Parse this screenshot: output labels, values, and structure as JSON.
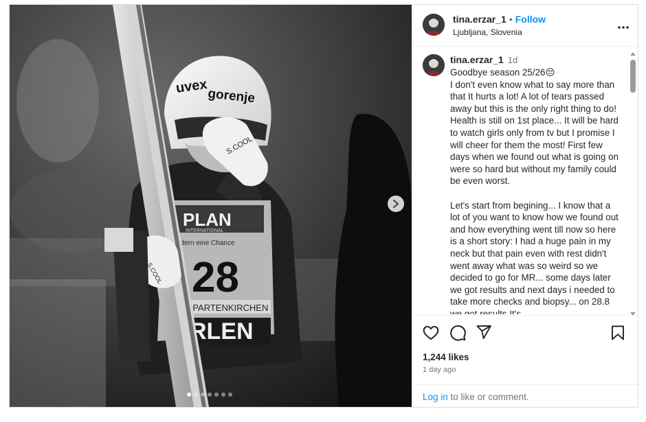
{
  "post": {
    "username": "tina.erzar_1",
    "separator": "•",
    "follow_label": "Follow",
    "location": "Ljubljana, Slovenia",
    "more_icon": "more-horizontal-icon",
    "media": {
      "bib_number": "28",
      "sponsor_text": "PLAN",
      "sponsor_sub": "INTERNATIONAL",
      "slogan": "ndern eine Chance",
      "venue": "-PARTENKIRCHEN",
      "brand_bottom": "RLEN",
      "helmet_brand_1": "uvex",
      "helmet_brand_2": "gorenje",
      "glove_brand": "S.COOL",
      "carousel_slides": 7,
      "carousel_active_index": 0
    },
    "caption": {
      "username": "tina.erzar_1",
      "time": "1d",
      "first_line": "Goodbye season 25/26😔",
      "paragraph_1": "I don't even know what to say more than that It hurts a lot! A lot of tears passed away but this is the only right thing to do! Health is still on 1st place... It will be hard to watch girls only from tv but I promise I will cheer for them the most! First few days when we found out what is going on were so hard but without my family could be even worst.",
      "paragraph_2": "Let's start from begining... I know that a lot of you want to know how we found out and how everything went till now so here is a short story: I had a huge pain in my neck but that pain even with rest didn't went away what was so weird so we decided to go for MR... some days later we got results and next days i needed to take more checks and biopsy... on 28.8 we got results It's"
    },
    "actions": {
      "like_icon": "heart-icon",
      "comment_icon": "comment-icon",
      "share_icon": "share-icon",
      "save_icon": "bookmark-icon"
    },
    "likes": "1,244 likes",
    "time_ago": "1 day ago",
    "login_link": "Log in",
    "login_suffix": " to like or comment."
  }
}
